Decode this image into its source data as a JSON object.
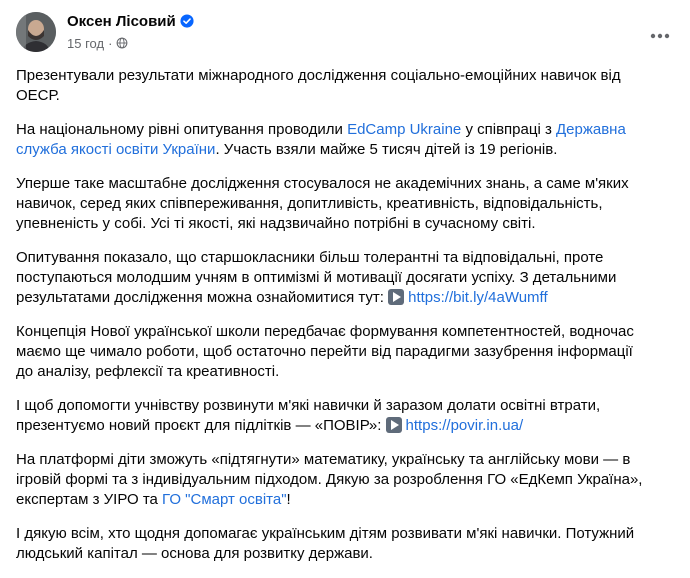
{
  "post": {
    "author": "Оксен Лісовий",
    "time": "15 год",
    "dot": "·",
    "paragraphs": {
      "p1": "Презентували результати міжнародного дослідження соціально-емоційних навичок від ОЕСР.",
      "p2": {
        "t1": "На національному рівні опитування проводили ",
        "link1": "EdCamp Ukraine",
        "t2": " у співпраці з ",
        "link2": "Державна служба якості освіти України",
        "t3": ". Участь взяли майже 5 тисяч дітей із 19 регіонів."
      },
      "p3": "Уперше таке масштабне дослідження стосувалося не академічних знань, а саме м'яких навичок, серед яких співпереживання, допитливість, креативність, відповідальність, упевненість у собі. Усі ті якості, які надзвичайно потрібні в сучасному світі.",
      "p4": {
        "t1": "Опитування показало, що старшокласники більш толерантні та відповідальні, проте поступаються молодшим учням в оптимізмі й мотивації досягати успіху. З детальними результатами дослідження можна ознайомитися тут: ",
        "link": "https://bit.ly/4aWumff"
      },
      "p5": "Концепція Нової української школи передбачає формування компетентностей, водночас маємо ще чимало роботи, щоб остаточно перейти від парадигми зазубрення інформації до аналізу, рефлексії та креативності.",
      "p6": {
        "t1": "І щоб допомогти учнівству розвинути м'які навички й заразом долати освітні втрати, презентуємо новий проєкт для підлітків — «ПОВІР»: ",
        "link": "https://povir.in.ua/"
      },
      "p7": {
        "t1": "На платформі діти зможуть «підтягнути» математику, українську та англійську мови — в ігровій формі та з індивідуальним підходом. Дякую за розроблення ГО «ЕдКемп Україна», експертам з УІРО та ",
        "link": "ГО \"Смарт освіта\"",
        "t2": "!"
      },
      "p8": "І дякую всім, хто щодня допомагає українським дітям розвивати м'які навички. Потужний людський капітал — основа для розвитку держави."
    }
  },
  "icons": {
    "verified": "verified-badge-icon",
    "globe": "globe-icon",
    "more": "more-options-icon",
    "arrow": "arrow-right-emoji-icon"
  },
  "colors": {
    "link": "#216fdb",
    "meta": "#65676b",
    "verified": "#0866ff"
  }
}
